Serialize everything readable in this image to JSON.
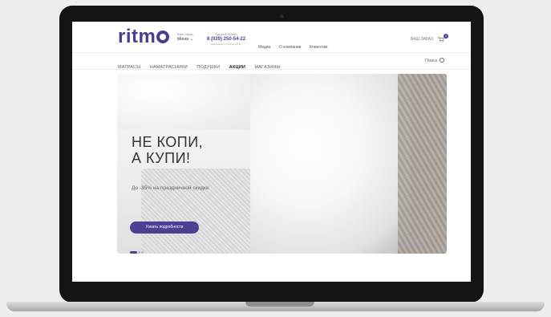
{
  "header": {
    "logo": "ritm",
    "city_label": "Ваш город",
    "city_value": "Минск",
    "phone_label": "Единый номер",
    "phone_number": "8 (029) 250-54-22",
    "phone_note": "Ежедневно с 9:00 до 21:00",
    "top_links": [
      "Медиа",
      "О компании",
      "Клиентам"
    ],
    "order_label": "ВАШ ЗАКАЗ",
    "cart_count": "0"
  },
  "nav": {
    "items": [
      "МАТРАСЫ",
      "НАМАТРАСНИКИ",
      "ПОДУШКИ",
      "АКЦИИ",
      "МАГАЗИНЫ"
    ],
    "active_index": 3,
    "search_label": "Поиск"
  },
  "hero": {
    "headline_line1": "НЕ КОПИ,",
    "headline_line2": "А КУПИ!",
    "subtext": "До -35% на праздничной скидке",
    "cta_label": "Узнать подробности",
    "slide_count": 3,
    "active_slide": 0
  },
  "colors": {
    "brand": "#4b3d8f",
    "background": "#ededed"
  }
}
